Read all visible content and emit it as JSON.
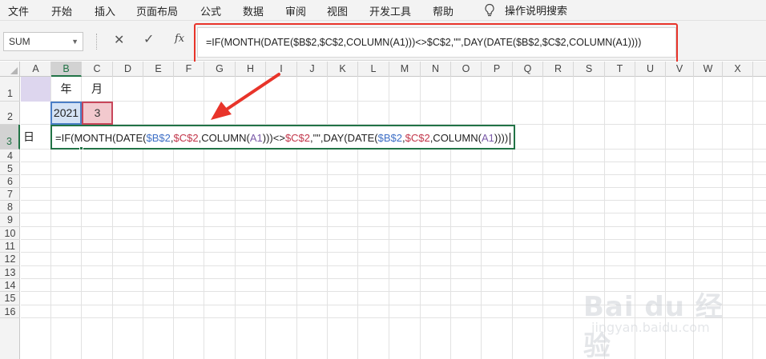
{
  "ribbon": {
    "tabs": [
      "文件",
      "开始",
      "插入",
      "页面布局",
      "公式",
      "数据",
      "审阅",
      "视图",
      "开发工具",
      "帮助"
    ],
    "tell_me": "操作说明搜索"
  },
  "formula_bar": {
    "name_box": "SUM",
    "cancel_icon": "close-icon",
    "enter_icon": "check-icon",
    "fx_label": "fx",
    "formula": "=IF(MONTH(DATE($B$2,$C$2,COLUMN(A1)))<>$C$2,\"\",DAY(DATE($B$2,$C$2,COLUMN(A1))))",
    "highlight_color": "#e8342a"
  },
  "sheet": {
    "columns": [
      "A",
      "B",
      "C",
      "D",
      "E",
      "F",
      "G",
      "H",
      "I",
      "J",
      "K",
      "L",
      "M",
      "N",
      "O",
      "P",
      "Q",
      "R",
      "S",
      "T",
      "U",
      "V",
      "W",
      "X"
    ],
    "rows": [
      "1",
      "2",
      "3",
      "4",
      "5",
      "6",
      "7",
      "8",
      "9",
      "10",
      "11",
      "12",
      "13",
      "14",
      "15",
      "16"
    ],
    "active_column": "B",
    "active_row": "3",
    "cells": {
      "B1": "年",
      "C1": "月",
      "B2": "2021",
      "C2": "3",
      "A3": "日"
    },
    "editing_cell": {
      "address": "B3",
      "parts": [
        {
          "text": "=IF(MONTH(DATE(",
          "ref": ""
        },
        {
          "text": "$B$2",
          "ref": "b"
        },
        {
          "text": ",",
          "ref": ""
        },
        {
          "text": "$C$2",
          "ref": "c"
        },
        {
          "text": ",COLUMN(",
          "ref": ""
        },
        {
          "text": "A1",
          "ref": "a"
        },
        {
          "text": ")))<>",
          "ref": ""
        },
        {
          "text": "$C$2",
          "ref": "c"
        },
        {
          "text": ",\"\",DAY(DATE(",
          "ref": ""
        },
        {
          "text": "$B$2",
          "ref": "b"
        },
        {
          "text": ",",
          "ref": ""
        },
        {
          "text": "$C$2",
          "ref": "c"
        },
        {
          "text": ",COLUMN(",
          "ref": ""
        },
        {
          "text": "A1",
          "ref": "a"
        },
        {
          "text": "))))",
          "ref": ""
        }
      ]
    },
    "colors": {
      "accent": "#217346",
      "ref_b": "#3d6fc6",
      "ref_c": "#c2364a",
      "ref_a": "#7a5aa8"
    }
  },
  "watermark": {
    "brand": "Bai du 经验",
    "url": "jingyan.baidu.com"
  }
}
